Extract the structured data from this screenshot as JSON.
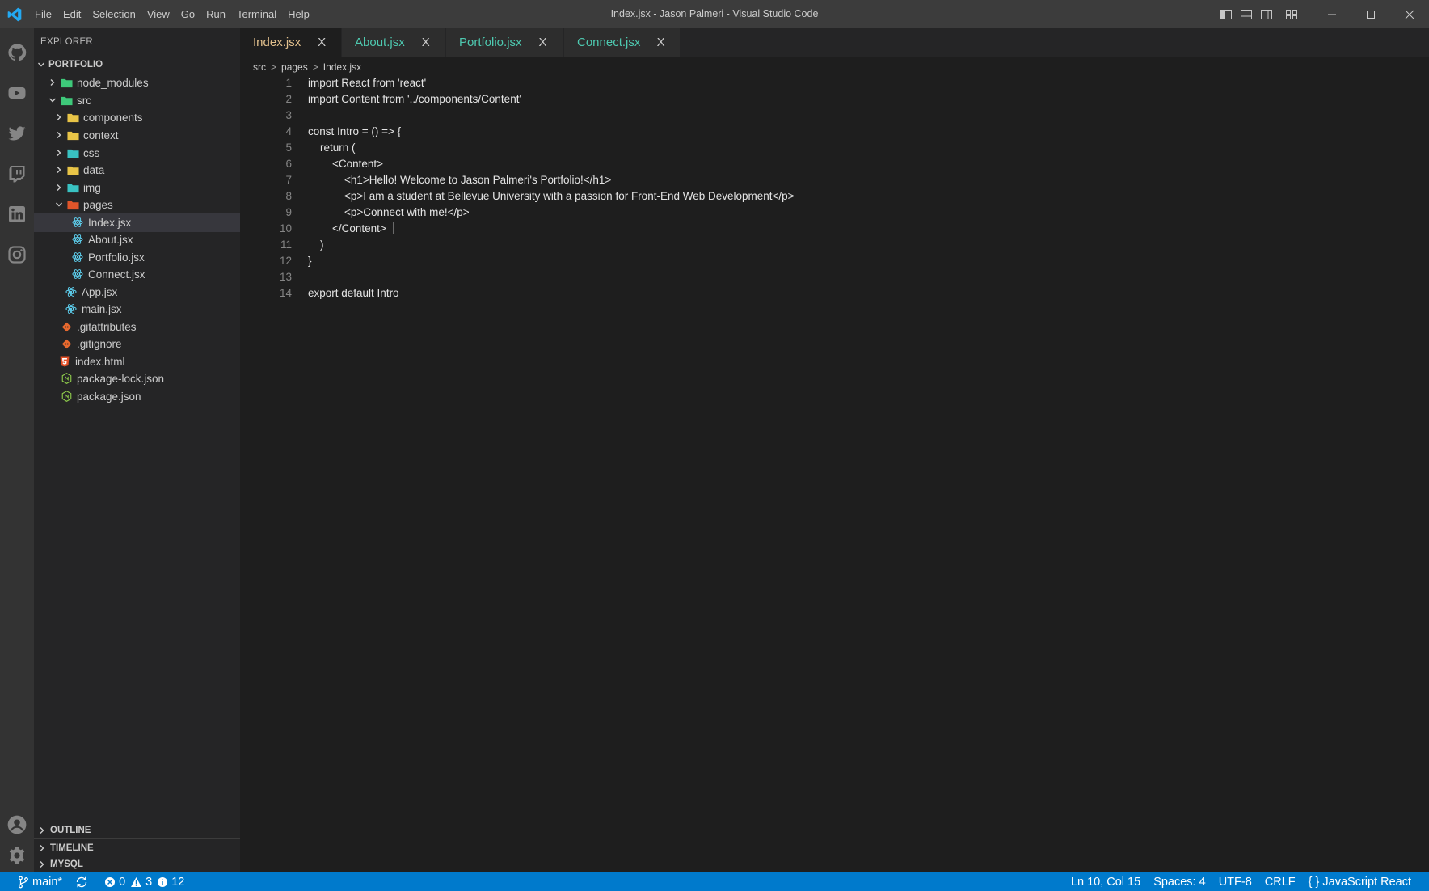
{
  "titlebar": {
    "menu": [
      "File",
      "Edit",
      "Selection",
      "View",
      "Go",
      "Run",
      "Terminal",
      "Help"
    ],
    "title": "Index.jsx - Jason Palmeri - Visual Studio Code"
  },
  "activity_icons": [
    "github-icon",
    "youtube-icon",
    "twitter-icon",
    "twitch-icon",
    "linkedin-icon",
    "instagram-icon",
    "account-icon",
    "settings-gear-icon"
  ],
  "sidebar": {
    "title": "EXPLORER",
    "root": "PORTFOLIO",
    "items": [
      {
        "label": "node_modules"
      },
      {
        "label": "src"
      },
      {
        "label": "components"
      },
      {
        "label": "context"
      },
      {
        "label": "css"
      },
      {
        "label": "data"
      },
      {
        "label": "img"
      },
      {
        "label": "pages"
      },
      {
        "label": "Index.jsx"
      },
      {
        "label": "About.jsx"
      },
      {
        "label": "Portfolio.jsx"
      },
      {
        "label": "Connect.jsx"
      },
      {
        "label": "App.jsx"
      },
      {
        "label": "main.jsx"
      },
      {
        "label": ".gitattributes"
      },
      {
        "label": ".gitignore"
      },
      {
        "label": "index.html"
      },
      {
        "label": "package-lock.json"
      },
      {
        "label": "package.json"
      }
    ],
    "sections": [
      "OUTLINE",
      "TIMELINE",
      "MYSQL"
    ]
  },
  "tabs": [
    {
      "label": "Index.jsx",
      "close": "X"
    },
    {
      "label": "About.jsx",
      "close": "X"
    },
    {
      "label": "Portfolio.jsx",
      "close": "X"
    },
    {
      "label": "Connect.jsx",
      "close": "X"
    }
  ],
  "breadcrumb": [
    "src",
    "pages",
    "Index.jsx"
  ],
  "breadcrumb_sep": ">",
  "code": {
    "line_numbers": [
      "1",
      "2",
      "3",
      "4",
      "5",
      "6",
      "7",
      "8",
      "9",
      "10",
      "11",
      "12",
      "13",
      "14"
    ],
    "lines": [
      "import React from 'react'",
      "import Content from '../components/Content'",
      "",
      "const Intro = () => {",
      "    return (",
      "        <Content>",
      "            <h1>Hello! Welcome to Jason Palmeri's Portfolio!</h1>",
      "            <p>I am a student at Bellevue University with a passion for Front-End Web Development</p>",
      "            <p>Connect with me!</p>",
      "        </Content>",
      "    )",
      "}",
      "",
      "export default Intro"
    ]
  },
  "statusbar": {
    "branch": "main*",
    "errors": "0",
    "warnings": "3",
    "infos": "12",
    "position": "Ln 10, Col 15",
    "spaces": "Spaces: 4",
    "encoding": "UTF-8",
    "eol": "CRLF",
    "language": "{ } JavaScript React"
  },
  "colors": {
    "accent": "#007acc",
    "folder_green": "#3ec97a",
    "folder_yellow": "#e8c447",
    "folder_teal": "#39c2c2",
    "folder_red": "#e0552a",
    "react_blue": "#61dafb"
  }
}
